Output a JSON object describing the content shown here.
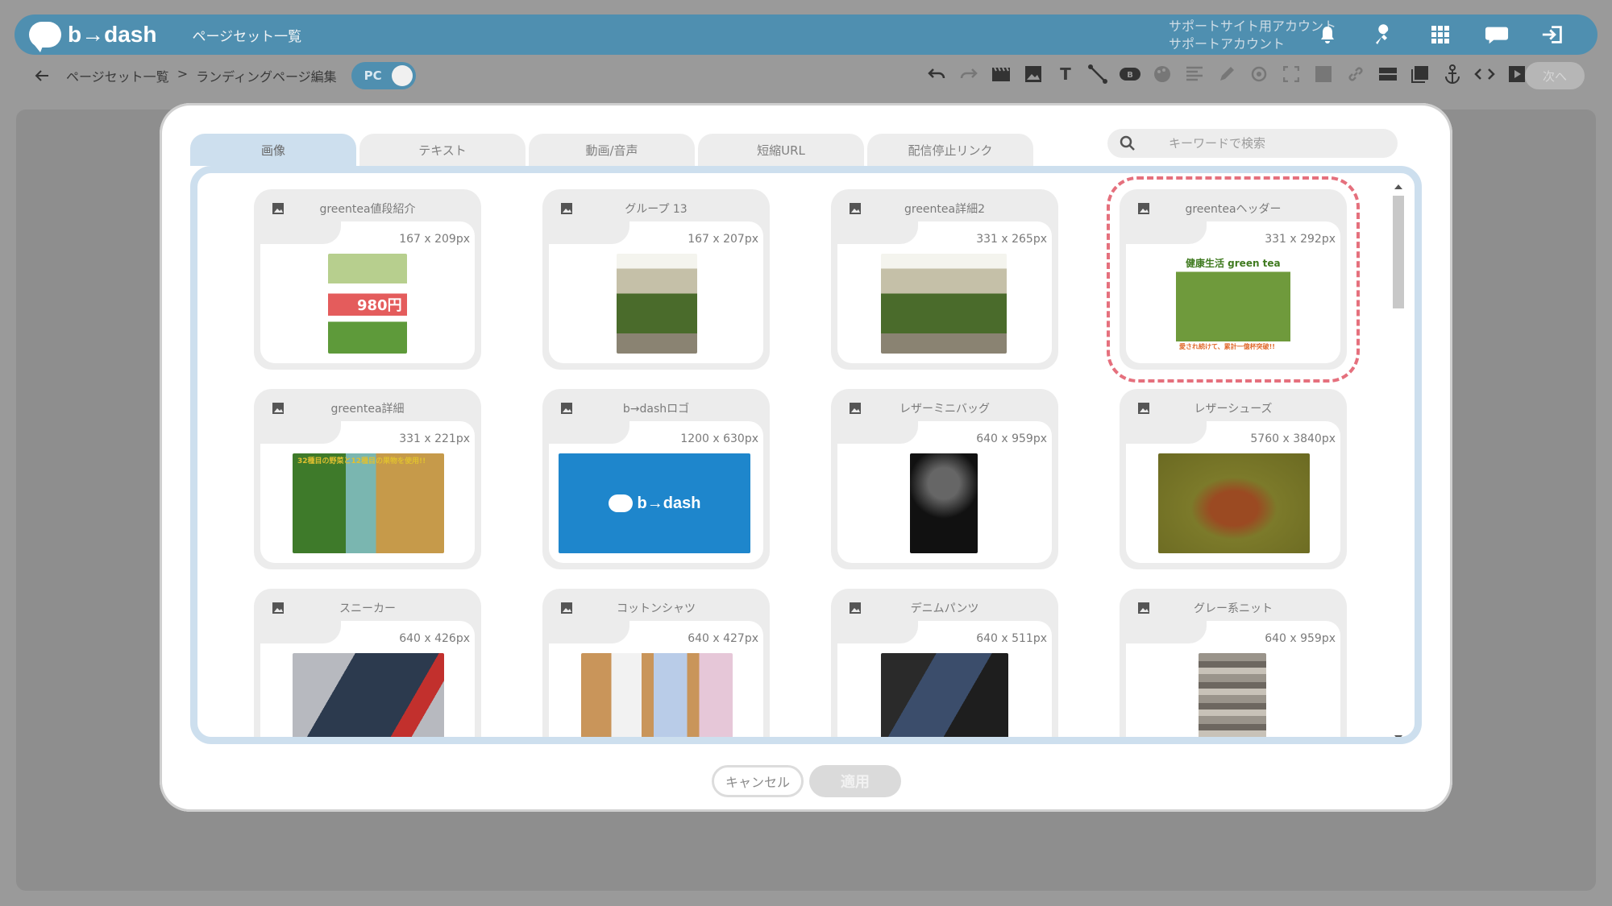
{
  "header": {
    "app_name": "b→dash",
    "page_title": "ページセット一覧",
    "account_line1": "サポートサイト用アカウント",
    "account_line2": "サポートアカウント"
  },
  "toolbar": {
    "breadcrumb_parent": "ページセット一覧",
    "breadcrumb_sep": ">",
    "breadcrumb_current": "ランディングページ編集",
    "device_toggle": "PC",
    "next_button": "次へ"
  },
  "modal": {
    "tabs": [
      "画像",
      "テキスト",
      "動画/音声",
      "短縮URL",
      "配信停止リンク"
    ],
    "search_placeholder": "キーワードで検索",
    "cards": [
      {
        "title": "greentea値段紹介",
        "size": "167 x 209px"
      },
      {
        "title": "グループ 13",
        "size": "167 x 207px"
      },
      {
        "title": "greentea詳細2",
        "size": "331 x 265px"
      },
      {
        "title": "greenteaヘッダー",
        "size": "331 x 292px"
      },
      {
        "title": "greentea詳細",
        "size": "331 x 221px"
      },
      {
        "title": "b→dashロゴ",
        "size": "1200 x 630px"
      },
      {
        "title": "レザーミニバッグ",
        "size": "640 x 959px"
      },
      {
        "title": "レザーシューズ",
        "size": "5760 x 3840px"
      },
      {
        "title": "スニーカー",
        "size": "640 x 426px"
      },
      {
        "title": "コットンシャツ",
        "size": "640 x 427px"
      },
      {
        "title": "デニムパンツ",
        "size": "640 x 511px"
      },
      {
        "title": "グレー系ニット",
        "size": "640 x 959px"
      }
    ],
    "thumb_text": {
      "price": "980円",
      "header_top": "健康生活 green tea",
      "header_bottom": "愛され続けて、累計一億杯突破!!",
      "detail_top": "32種目の野菜と12種目の果物を使用!!",
      "logo_text": "b→dash"
    },
    "cancel_label": "キャンセル",
    "apply_label": "適用"
  },
  "colors": {
    "header_bg": "#4f8fb0",
    "tab_active": "#cddfee",
    "selected_outline": "#e5707d"
  }
}
